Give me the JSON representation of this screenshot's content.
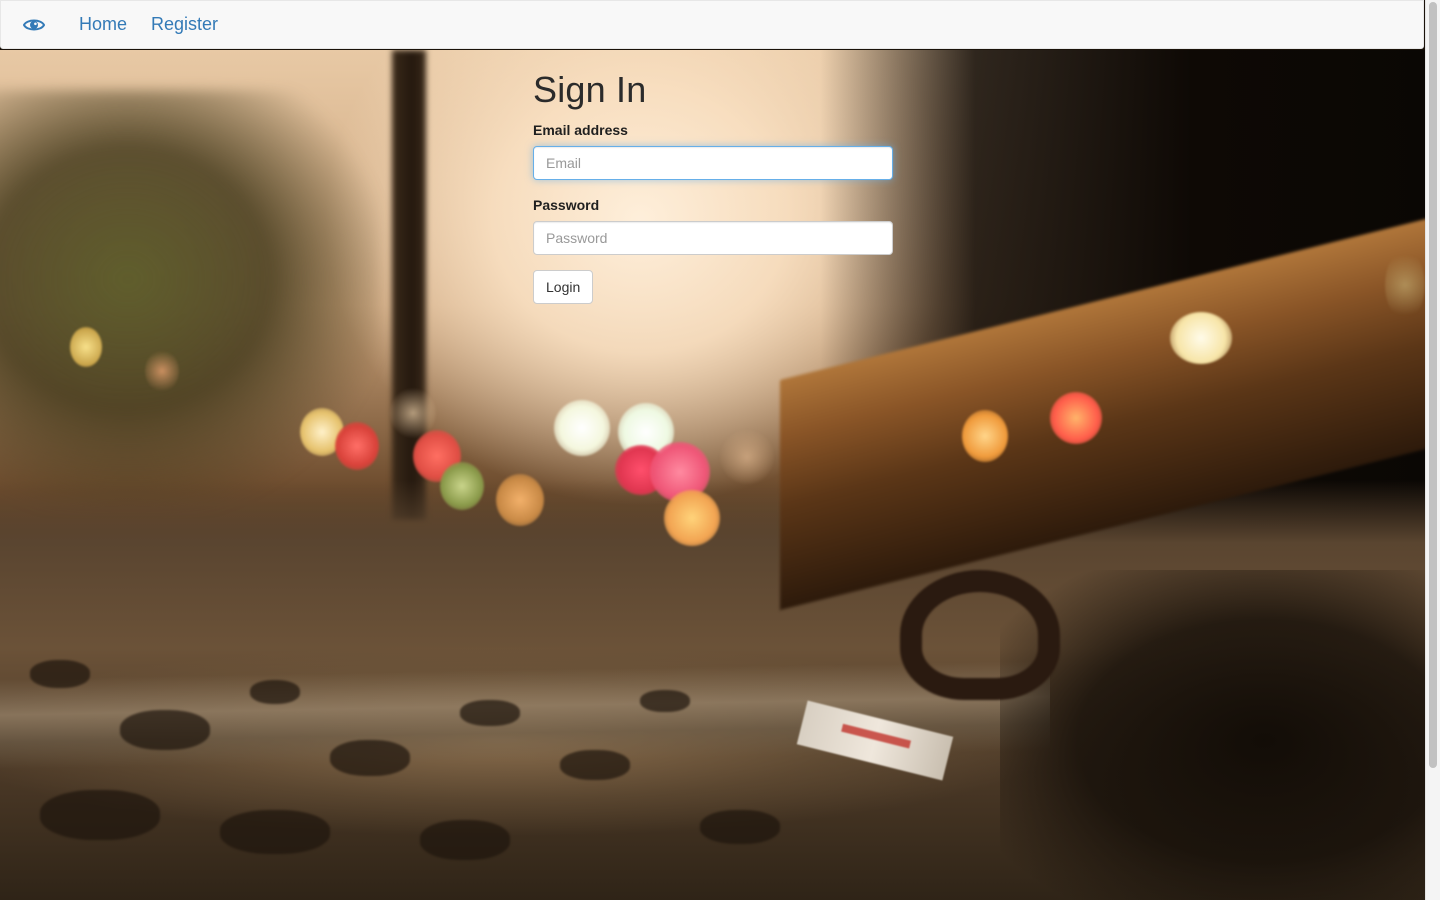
{
  "navbar": {
    "brand_icon": "eye-icon",
    "links": [
      {
        "label": "Home"
      },
      {
        "label": "Register"
      }
    ],
    "link_color": "#337ab7"
  },
  "form": {
    "title": "Sign In",
    "email": {
      "label": "Email address",
      "placeholder": "Email",
      "value": ""
    },
    "password": {
      "label": "Password",
      "placeholder": "Password",
      "value": ""
    },
    "submit_label": "Login"
  },
  "background": {
    "description_icon": "railway-track-bokeh-photo"
  },
  "colors": {
    "focus_border": "#66afe9",
    "navbar_bg": "#f8f8f8"
  }
}
